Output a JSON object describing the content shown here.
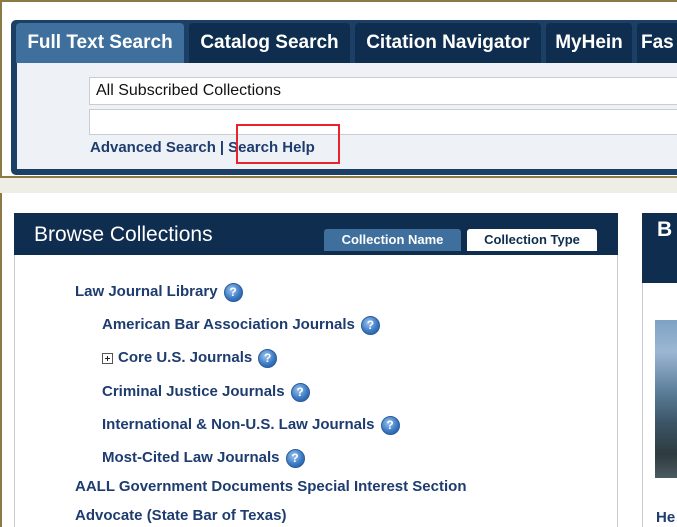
{
  "search": {
    "tabs": [
      "Full Text Search",
      "Catalog Search",
      "Citation Navigator",
      "MyHein",
      "Fas"
    ],
    "collection_value": "All Subscribed Collections",
    "query_value": "",
    "advanced_link": "Advanced Search",
    "separator": "|",
    "help_link": "Search Help"
  },
  "browse": {
    "title": "Browse Collections",
    "tabs": [
      "Collection Name",
      "Collection Type"
    ],
    "items": [
      "Law Journal Library",
      "American Bar Association Journals",
      "Core U.S. Journals",
      "Criminal Justice Journals",
      "International & Non-U.S. Law Journals",
      "Most-Cited Law Journals",
      "AALL Government Documents Special Interest Section",
      "Advocate (State Bar of Texas)"
    ]
  },
  "side": {
    "title": "B",
    "text": "He"
  },
  "icons": {
    "help": "help-question-icon",
    "expand": "plus-box-icon"
  },
  "colors": {
    "navy": "#0f2d4f",
    "active_tab": "#3e6f9d",
    "link": "#1e3c6f",
    "highlight": "#e8232a"
  }
}
